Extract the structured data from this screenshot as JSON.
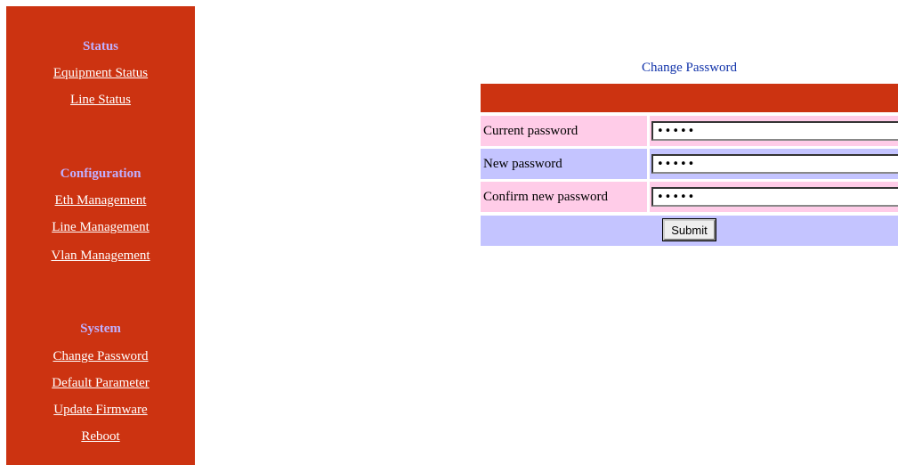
{
  "sidebar": {
    "sections": [
      {
        "title": "Status",
        "links": [
          "Equipment Status",
          "Line Status"
        ]
      },
      {
        "title": "Configuration",
        "links": [
          "Eth Management",
          "Line Management",
          "Vlan Management"
        ]
      },
      {
        "title": "System",
        "links": [
          "Change Password",
          "Default Parameter",
          "Update Firmware",
          "Reboot"
        ]
      }
    ]
  },
  "form": {
    "title": "Change Password",
    "fields": [
      {
        "label": "Current password",
        "value": "•••••"
      },
      {
        "label": "New password",
        "value": "•••••"
      },
      {
        "label": "Confirm new password",
        "value": "•••••"
      }
    ],
    "submit_label": "Submit"
  },
  "colors": {
    "sidebar_bg": "#cc3311",
    "section_title": "#c0b0ff",
    "row_pink": "#ffcce8",
    "row_lavender": "#c4c4ff",
    "title_blue": "#1133aa"
  }
}
